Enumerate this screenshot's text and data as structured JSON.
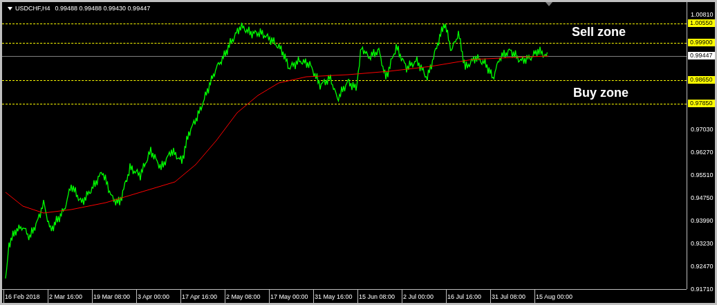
{
  "chart_header": {
    "symbol": "USDCHF,H4",
    "quotes": "0.99488 0.99488 0.99430 0.99447"
  },
  "zone_labels": [
    "Sell zone",
    "Buy zone"
  ],
  "price_lines": [
    {
      "label": "1.00550",
      "kind": "level",
      "color": "#ffff00"
    },
    {
      "label": "0.99900",
      "kind": "level",
      "color": "#ffff00"
    },
    {
      "label": "0.99447",
      "kind": "bid",
      "color": "#808080"
    },
    {
      "label": "0.98650",
      "kind": "level",
      "color": "#ffff00"
    },
    {
      "label": "0.97850",
      "kind": "level",
      "color": "#ffff00"
    }
  ],
  "price_axis": [
    "1.00810",
    "0.97030",
    "0.96270",
    "0.95510",
    "0.94750",
    "0.93990",
    "0.93230",
    "0.92470",
    "0.91710"
  ],
  "time_axis": [
    "16 Feb 2018",
    "2 Mar 16:00",
    "19 Mar 08:00",
    "3 Apr 00:00",
    "17 Apr 16:00",
    "2 May 08:00",
    "17 May 00:00",
    "31 May 16:00",
    "15 Jun 08:00",
    "2 Jul 00:00",
    "16 Jul 16:00",
    "31 Jul 08:00",
    "15 Aug 00:00"
  ]
}
